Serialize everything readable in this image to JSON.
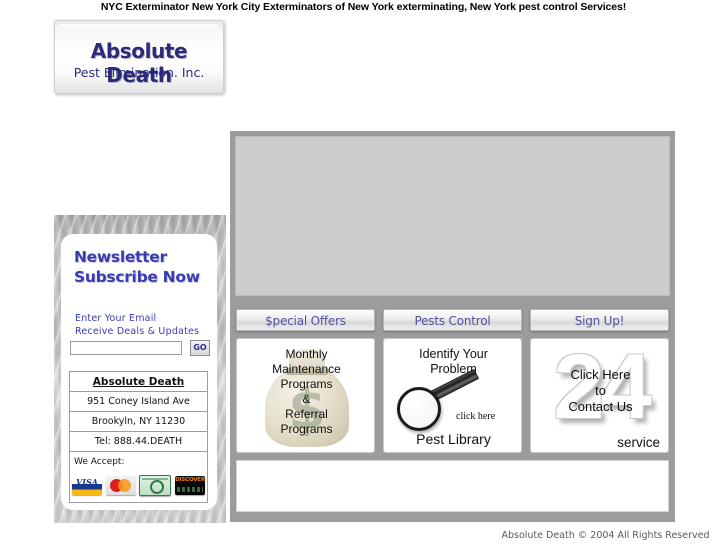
{
  "tagline": "NYC Exterminator New York City Exterminators of New York exterminating,  New York pest control Services!",
  "logo": {
    "title": "Absolute Death",
    "subtitle": "Pest Elimination. Inc.",
    "color": "#2b2b7a"
  },
  "sidebar": {
    "newsletter": {
      "title_line1": "Newsletter",
      "title_line2": "Subscribe Now",
      "sub_line1": "Enter Your Email",
      "sub_line2": "Receive Deals & Updates",
      "input_value": "",
      "input_placeholder": "",
      "go_label": "GO",
      "title_color": "#3b3bb0"
    },
    "address": {
      "name": "Absolute Death",
      "street": "951 Coney Island Ave",
      "city": "Brookyln, NY 11230",
      "phone": "Tel: 888.44.DEATH",
      "accept_label": "We Accept:",
      "cards": [
        "VISA",
        "MasterCard",
        "American Express",
        "Discover"
      ],
      "visa_text": "VISA",
      "discover_text": "DISCOVER"
    }
  },
  "main": {
    "tabs": [
      {
        "label": "$pecial Offers"
      },
      {
        "label": "Pests Control"
      },
      {
        "label": "Sign Up!"
      }
    ],
    "panels": {
      "offers": {
        "line1": "Monthly",
        "line2": "Maintenance",
        "line3": "Programs",
        "line4": "&",
        "line5": "Referral",
        "line6": "Programs",
        "bag_symbol": "$"
      },
      "pests": {
        "title_line1": "Identify Your",
        "title_line2": "Problem",
        "click_here": "click here",
        "footer": "Pest Library"
      },
      "signup": {
        "watermark": "24",
        "line1": "Click Here",
        "line2": "to",
        "line3": "Contact Us",
        "service": "service"
      }
    }
  },
  "footer": {
    "copyright": "Absolute Death © 2004 All Rights Reserved"
  }
}
